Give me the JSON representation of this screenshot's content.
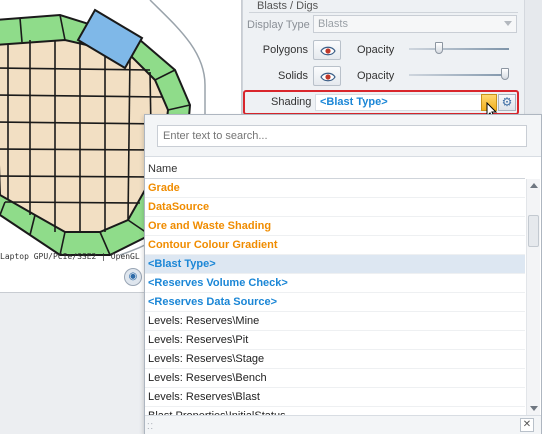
{
  "viewport": {
    "gpu_text": "Laptop GPU/PCIe/SSE2 | OpenGL",
    "view_icon": "globe-eye-icon"
  },
  "properties": {
    "group_title": "Blasts / Digs",
    "display_type": {
      "label": "Display Type",
      "value": "Blasts"
    },
    "polygons": {
      "label": "Polygons",
      "opacity_label": "Opacity",
      "opacity": 0.3
    },
    "solids": {
      "label": "Solids",
      "opacity_label": "Opacity",
      "opacity": 1.0
    },
    "shading": {
      "label": "Shading",
      "value": "<Blast Type>"
    }
  },
  "popup": {
    "search_placeholder": "Enter text to search...",
    "column_header": "Name",
    "items": [
      {
        "label": "Grade",
        "style": "orange"
      },
      {
        "label": "DataSource",
        "style": "orange"
      },
      {
        "label": "Ore and Waste Shading",
        "style": "orange"
      },
      {
        "label": "Contour Colour Gradient",
        "style": "orange"
      },
      {
        "label": "<Blast Type>",
        "style": "blue",
        "selected": true
      },
      {
        "label": "<Reserves Volume Check>",
        "style": "blue"
      },
      {
        "label": "<Reserves Data Source>",
        "style": "blue"
      },
      {
        "label": "Levels: Reserves\\Mine",
        "style": "plain"
      },
      {
        "label": "Levels: Reserves\\Pit",
        "style": "plain"
      },
      {
        "label": "Levels: Reserves\\Stage",
        "style": "plain"
      },
      {
        "label": "Levels: Reserves\\Bench",
        "style": "plain"
      },
      {
        "label": "Levels: Reserves\\Blast",
        "style": "plain"
      },
      {
        "label": "Blast Properties\\InitialStatus",
        "style": "plain"
      }
    ],
    "close_glyph": "✕",
    "grip_glyph": "⁚⁚"
  },
  "colors": {
    "accent_blue": "#1a86d6",
    "accent_orange": "#f08c00",
    "highlight_red": "#d9262c",
    "block_fill": "#f2dfc3",
    "ring_green": "#8fdc8a",
    "selected_block": "#7fb8e8"
  }
}
